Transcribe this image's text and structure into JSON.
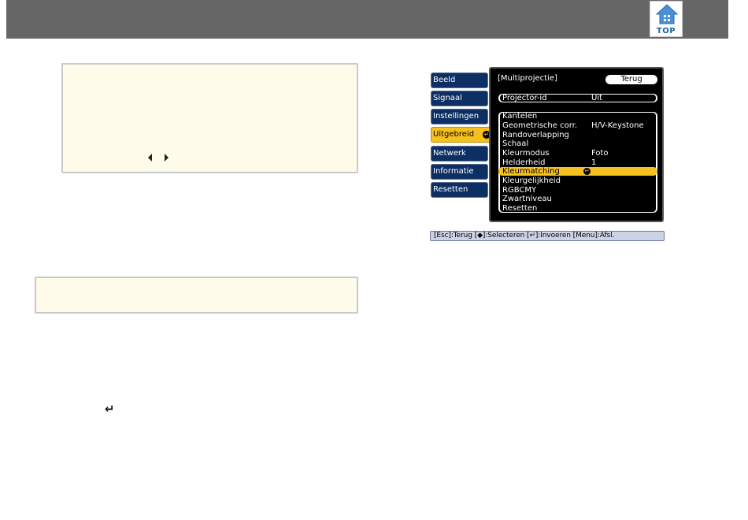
{
  "header": {
    "top_label": "TOP"
  },
  "menu": {
    "side_tabs": [
      {
        "label": "Beeld"
      },
      {
        "label": "Signaal"
      },
      {
        "label": "Instellingen"
      },
      {
        "label": "Uitgebreid",
        "active": true
      },
      {
        "label": "Netwerk"
      },
      {
        "label": "Informatie"
      },
      {
        "label": "Resetten"
      }
    ],
    "panel_title": "[Multiprojectie]",
    "back_label": "Terug",
    "items": [
      {
        "label": "Projector-id",
        "value": "Uit"
      },
      {
        "label": "Kantelen",
        "value": ""
      },
      {
        "label": "Geometrische corr.",
        "value": "H/V-Keystone"
      },
      {
        "label": "Randoverlapping",
        "value": ""
      },
      {
        "label": "Schaal",
        "value": ""
      },
      {
        "label": "Kleurmodus",
        "value": "Foto"
      },
      {
        "label": "Helderheid",
        "value": "1"
      },
      {
        "label": "Kleurmatching",
        "value": "",
        "selected": true
      },
      {
        "label": "Kleurgelijkheid",
        "value": ""
      },
      {
        "label": "RGBCMY",
        "value": ""
      },
      {
        "label": "Zwartniveau",
        "value": ""
      },
      {
        "label": "Resetten",
        "value": ""
      }
    ],
    "footer": "[Esc]:Terug [◆]:Selecteren [↵]:Invoeren  [Menu]:Afsl."
  },
  "colors": {
    "header_bg": "#666666",
    "note_bg": "#fffbeb",
    "menu_tab": "#0d2f63",
    "menu_highlight": "#f5c020"
  }
}
